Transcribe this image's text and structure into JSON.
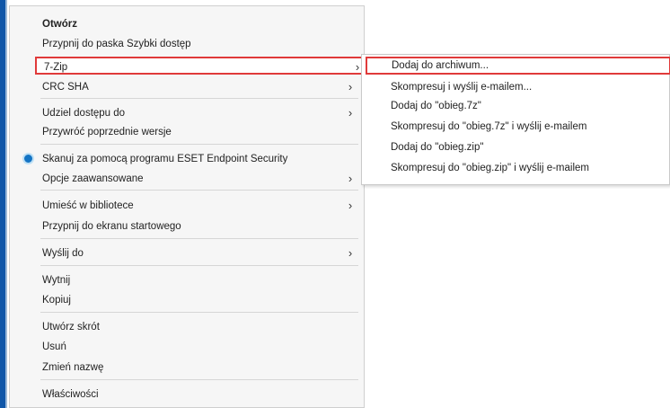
{
  "context_menu": {
    "items": [
      {
        "label": "Otwórz"
      },
      {
        "label": "Przypnij do paska Szybki dostęp"
      },
      {
        "label": "7-Zip",
        "arrow": "›"
      },
      {
        "label": "CRC SHA",
        "arrow": "›"
      },
      {
        "label": "Udziel dostępu do",
        "arrow": "›"
      },
      {
        "label": "Przywróć poprzednie wersje"
      },
      {
        "label": "Skanuj za pomocą programu ESET Endpoint Security",
        "icon": "eset-icon"
      },
      {
        "label": "Opcje zaawansowane",
        "arrow": "›"
      },
      {
        "label": "Umieść w bibliotece",
        "arrow": "›"
      },
      {
        "label": "Przypnij do ekranu startowego"
      },
      {
        "label": "Wyślij do",
        "arrow": "›"
      },
      {
        "label": "Wytnij"
      },
      {
        "label": "Kopiuj"
      },
      {
        "label": "Utwórz skrót"
      },
      {
        "label": "Usuń"
      },
      {
        "label": "Zmień nazwę"
      },
      {
        "label": "Właściwości"
      }
    ]
  },
  "submenu_7zip": {
    "items": [
      {
        "label": "Dodaj do archiwum..."
      },
      {
        "label": "Skompresuj i wyślij e-mailem..."
      },
      {
        "label": "Dodaj do \"obieg.7z\""
      },
      {
        "label": "Skompresuj do \"obieg.7z\" i wyślij e-mailem"
      },
      {
        "label": "Dodaj do \"obieg.zip\""
      },
      {
        "label": "Skompresuj do \"obieg.zip\" i wyślij e-mailem"
      }
    ]
  },
  "colors": {
    "highlight_border": "#e03a3a",
    "menu_background": "#f6f6f6",
    "frame_accent": "#0f56a8"
  }
}
